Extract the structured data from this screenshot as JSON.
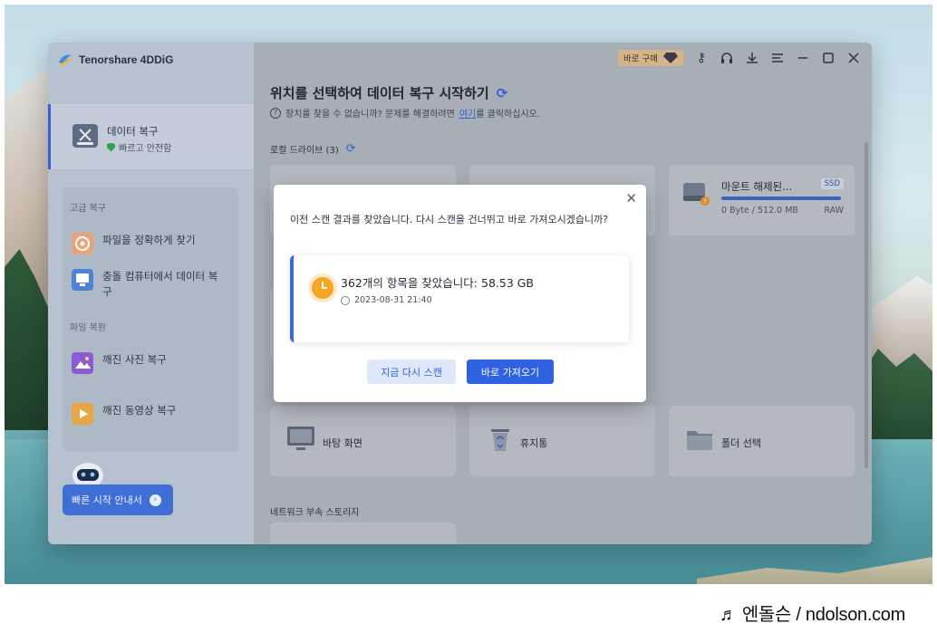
{
  "app": {
    "name": "Tenorshare 4DDiG"
  },
  "toolbar": {
    "buy_label": "바로 구매"
  },
  "sidebar": {
    "active_item": {
      "title": "데이터 복구",
      "subtitle": "빠르고 안전함"
    },
    "section_advanced": "고급 복구",
    "advanced_items": [
      {
        "label": "파일을 정확하게 찾기"
      },
      {
        "label": "충돌 컴퓨터에서 데이터 복구"
      }
    ],
    "section_repair": "파일 복원",
    "repair_items": [
      {
        "label": "깨진 사진 복구"
      },
      {
        "label": "깨진 동영상 복구"
      }
    ],
    "quick_start": "빠른 시작 안내서"
  },
  "main": {
    "title": "위치를 선택하여 데이터 복구 시작하기",
    "help_prefix": "장치를 찾을 수 없습니까? 문제를 해결하려면",
    "help_link": "여기",
    "help_suffix": "를 클릭하십시오.",
    "local_drives_label": "로컬 드라이브 (3)",
    "drive_card": {
      "name": "마운트 해제된...",
      "type": "SSD",
      "size": "0 Byte / 512.0 MB",
      "fs": "RAW"
    },
    "locations": [
      {
        "label": "바탕 화면",
        "icon": "monitor-icon"
      },
      {
        "label": "휴지통",
        "icon": "recycle-bin-icon"
      },
      {
        "label": "폴더 선택",
        "icon": "folder-icon"
      }
    ],
    "network_label": "네트워크 부속 스토리지"
  },
  "dialog": {
    "message": "이전 스캔 결과를 찾았습니다. 다시 스캔을 건너뛰고 바로 가져오시겠습니까?",
    "result_count": "362개의 항목을 찾았습니다: 58.53 GB",
    "result_time": "2023-08-31 21:40",
    "rescan_label": "지금 다시 스캔",
    "import_label": "바로 가져오기"
  },
  "watermark": "♬ 엔돌슨 / ndolson.com",
  "colors": {
    "accent": "#2f62e0",
    "dialog_bar": "#3a6bde",
    "clock": "#f5a623"
  }
}
